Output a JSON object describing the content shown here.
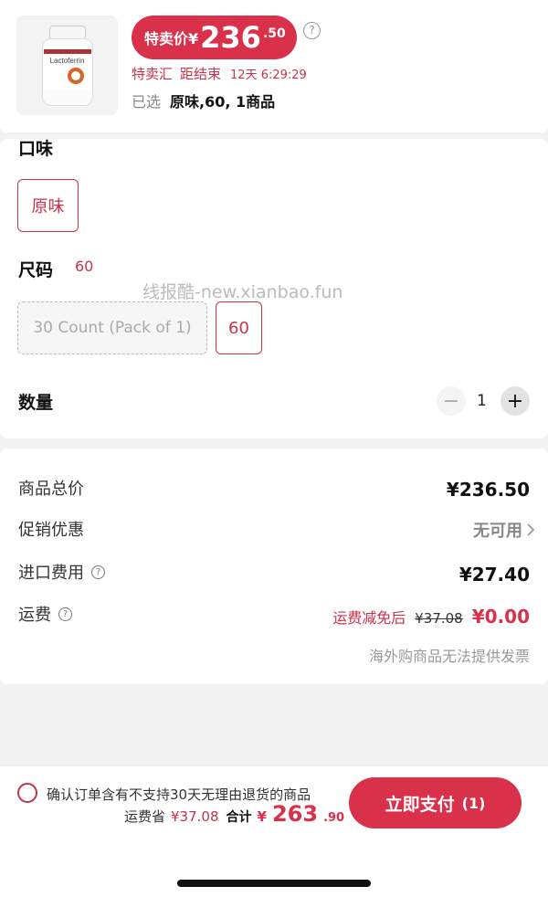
{
  "product": {
    "image_label": "Lactoferrin",
    "price_prefix": "特卖价¥",
    "price_integer": "236",
    "price_decimal": ".50",
    "help_symbol": "?",
    "sale_name": "特卖汇",
    "countdown_label": "距结束",
    "countdown_value": "12天 6:29:29",
    "selected_label": "已选",
    "selected_value": "原味,60, 1商品"
  },
  "options": {
    "flavor_title": "口味",
    "flavor_chip": "原味",
    "size_title": "尺码",
    "size_value": "60",
    "size_options": [
      "30 Count (Pack of 1)",
      "60"
    ],
    "quantity_title": "数量",
    "quantity_value": "1",
    "minus_symbol": "−",
    "plus_symbol": "+",
    "watermark": "线报酷-new.xianbao.fun"
  },
  "summary": {
    "subtotal_label": "商品总价",
    "subtotal_value": "¥236.50",
    "promo_label": "促销优惠",
    "promo_value": "无可用",
    "import_label": "进口费用",
    "import_value": "¥27.40",
    "shipping_label": "运费",
    "shipping_tag": "运费减免后",
    "shipping_original": "¥37.08",
    "shipping_final": "¥0.00",
    "invoice_note": "海外购商品无法提供发票"
  },
  "footer": {
    "confirm_text": "确认订单含有不支持30天无理由退货的商品",
    "save_label": "运费省",
    "save_value": "¥37.08",
    "total_label": "合计",
    "total_currency": "¥",
    "total_integer": "263",
    "total_decimal": ".90",
    "pay_label": "立即支付",
    "pay_count": "(1)"
  },
  "colors": {
    "accent": "#d9314a",
    "accent_text": "#c8324a",
    "background": "#f2f2f2"
  }
}
